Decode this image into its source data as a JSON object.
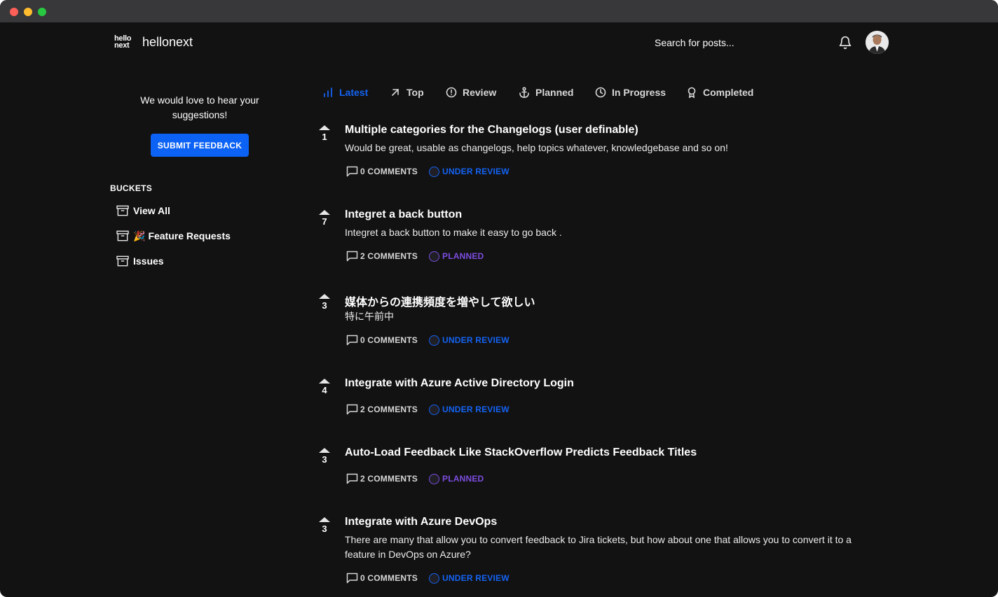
{
  "header": {
    "logo_line1": "hello",
    "logo_line2": "next",
    "brand": "hellonext",
    "search_placeholder": "Search for posts..."
  },
  "sidebar": {
    "invite_text": "We would love to hear your suggestions!",
    "submit_label": "SUBMIT FEEDBACK",
    "buckets_title": "BUCKETS",
    "buckets": [
      {
        "label": "View All",
        "emoji": ""
      },
      {
        "label": "Feature Requests",
        "emoji": "🎉"
      },
      {
        "label": "Issues",
        "emoji": ""
      }
    ]
  },
  "tabs": [
    {
      "label": "Latest",
      "icon": "bar-chart-icon",
      "active": true
    },
    {
      "label": "Top",
      "icon": "arrow-up-right-icon",
      "active": false
    },
    {
      "label": "Review",
      "icon": "alert-circle-icon",
      "active": false
    },
    {
      "label": "Planned",
      "icon": "anchor-icon",
      "active": false
    },
    {
      "label": "In Progress",
      "icon": "clock-icon",
      "active": false
    },
    {
      "label": "Completed",
      "icon": "award-icon",
      "active": false
    }
  ],
  "posts": [
    {
      "votes": "1",
      "title": "Multiple categories for the Changelogs (user definable)",
      "description": "Would be great, usable as changelogs, help topics whatever, knowledgebase and so on!",
      "comments": "0 COMMENTS",
      "status": "UNDER REVIEW"
    },
    {
      "votes": "7",
      "title": "Integret a back button",
      "description": "Integret a back button to make it easy to go back .",
      "comments": "2 COMMENTS",
      "status": "PLANNED"
    },
    {
      "votes": "3",
      "title": "媒体からの連携頻度を増やして欲しい",
      "description": "特に午前中",
      "comments": "0 COMMENTS",
      "status": "UNDER REVIEW"
    },
    {
      "votes": "4",
      "title": "Integrate with Azure Active Directory Login",
      "description": "",
      "comments": "2 COMMENTS",
      "status": "UNDER REVIEW"
    },
    {
      "votes": "3",
      "title": "Auto-Load Feedback Like StackOverflow Predicts Feedback Titles",
      "description": "",
      "comments": "2 COMMENTS",
      "status": "PLANNED"
    },
    {
      "votes": "3",
      "title": "Integrate with Azure DevOps",
      "description": "There are many that allow you to convert feedback to Jira tickets, but how about one that allows you to convert it to a feature in DevOps on Azure?",
      "comments": "0 COMMENTS",
      "status": "UNDER REVIEW"
    }
  ],
  "colors": {
    "background": "#121213",
    "accent": "#1463f3",
    "planned": "#7c4dde",
    "button": "#0b62f5"
  }
}
